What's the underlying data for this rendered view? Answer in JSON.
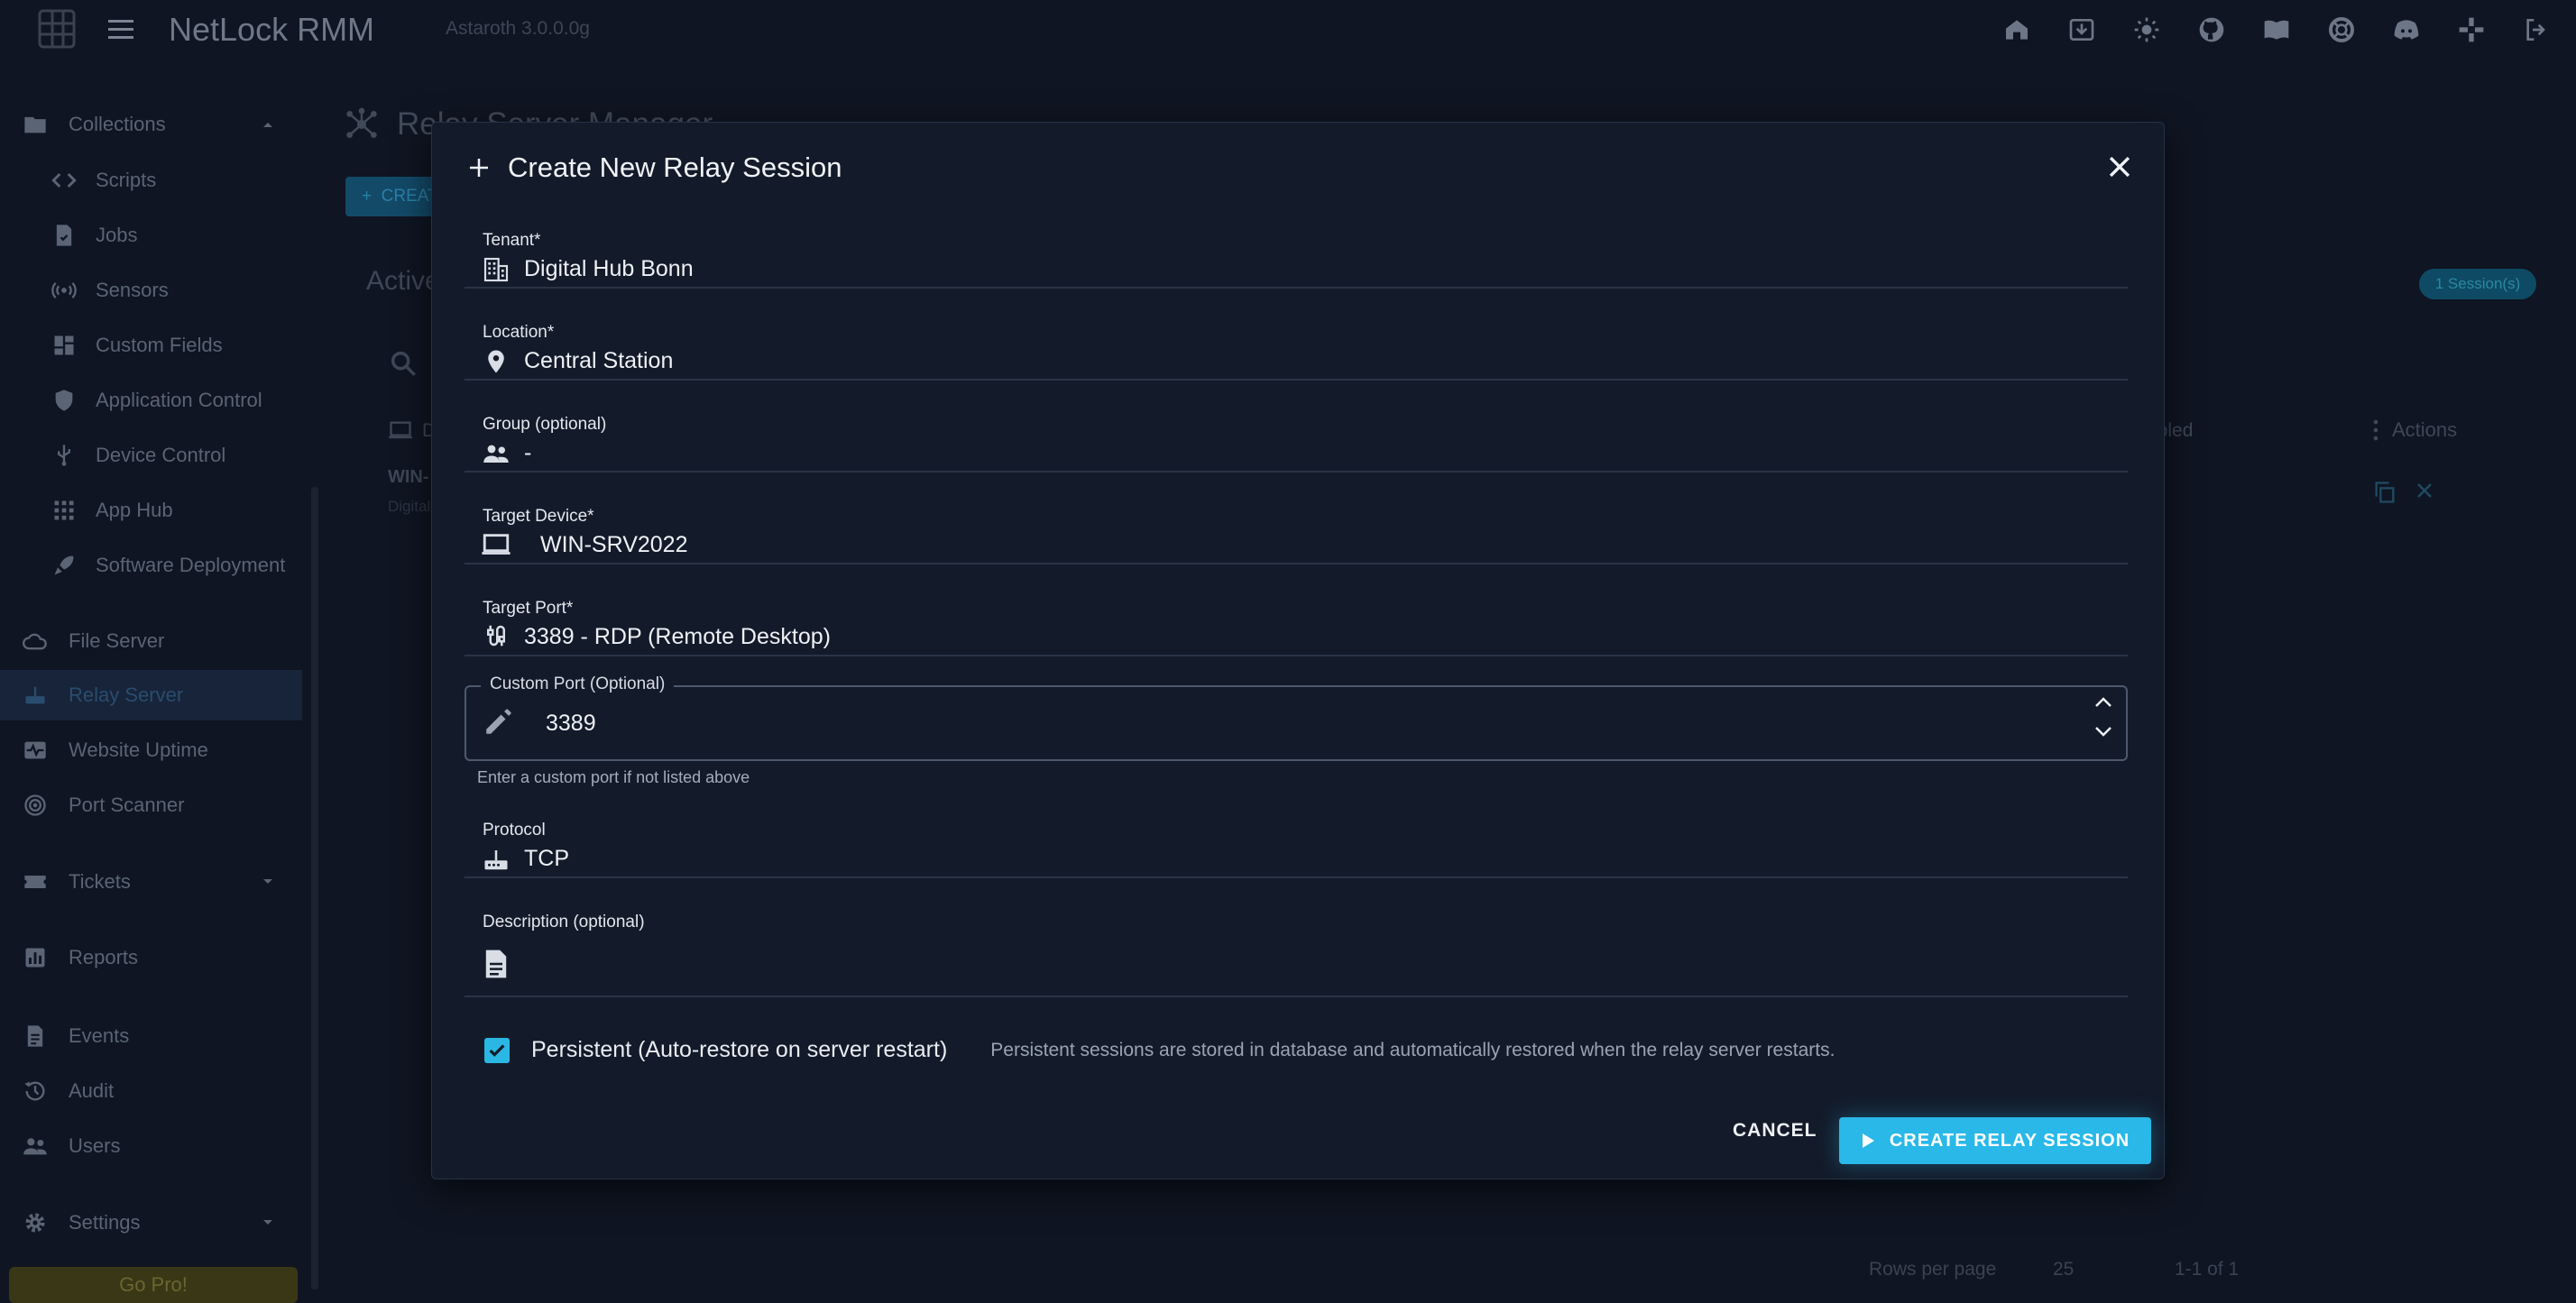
{
  "app": {
    "title": "NetLock RMM",
    "version": "Astaroth 3.0.0.0g"
  },
  "sidebar": {
    "items": [
      {
        "label": "Collections",
        "icon": "folder-icon"
      },
      {
        "label": "Scripts",
        "icon": "code-icon"
      },
      {
        "label": "Jobs",
        "icon": "job-icon"
      },
      {
        "label": "Sensors",
        "icon": "sensor-icon"
      },
      {
        "label": "Custom Fields",
        "icon": "dashboard-icon"
      },
      {
        "label": "Application Control",
        "icon": "shield-icon"
      },
      {
        "label": "Device Control",
        "icon": "usb-icon"
      },
      {
        "label": "App Hub",
        "icon": "apps-grid-icon"
      },
      {
        "label": "Software Deployment",
        "icon": "rocket-icon"
      },
      {
        "label": "File Server",
        "icon": "cloud-icon"
      },
      {
        "label": "Relay Server",
        "icon": "router-icon"
      },
      {
        "label": "Website Uptime",
        "icon": "monitor-heart-icon"
      },
      {
        "label": "Port Scanner",
        "icon": "radar-icon"
      },
      {
        "label": "Tickets",
        "icon": "ticket-icon"
      },
      {
        "label": "Reports",
        "icon": "bar-chart-icon"
      },
      {
        "label": "Events",
        "icon": "events-icon"
      },
      {
        "label": "Audit",
        "icon": "history-icon"
      },
      {
        "label": "Users",
        "icon": "people-icon"
      },
      {
        "label": "Settings",
        "icon": "gear-icon"
      }
    ],
    "go_pro": "Go Pro!"
  },
  "background": {
    "page_title": "Relay Server Manager",
    "create_label": "CREATE",
    "active_heading": "Active",
    "sessions_badge": "1 Session(s)",
    "col_device": "D",
    "row_device": "WIN-",
    "row_sub": "Digital",
    "col_enabled": "abled",
    "col_actions": "Actions",
    "rows_per_page_label": "Rows per page",
    "rows_per_page_value": "25",
    "page_range": "1-1 of 1"
  },
  "dialog": {
    "title": "Create New Relay Session",
    "fields": {
      "tenant": {
        "label": "Tenant*",
        "value": "Digital Hub Bonn",
        "icon": "building-icon"
      },
      "location": {
        "label": "Location*",
        "value": "Central Station",
        "icon": "location-pin-icon"
      },
      "group": {
        "label": "Group (optional)",
        "value": "-",
        "icon": "people-icon"
      },
      "target_device": {
        "label": "Target Device*",
        "value": "WIN-SRV2022",
        "icon": "laptop-icon"
      },
      "target_port": {
        "label": "Target Port*",
        "value": "3389 - RDP (Remote Desktop)",
        "icon": "cable-icon"
      },
      "custom_port": {
        "label": "Custom Port (Optional)",
        "value": "3389",
        "helper": "Enter a custom port if not listed above",
        "icon": "pencil-icon"
      },
      "protocol": {
        "label": "Protocol",
        "value": "TCP",
        "icon": "router-icon"
      },
      "description": {
        "label": "Description (optional)",
        "value": "",
        "icon": "document-icon"
      }
    },
    "persistent": {
      "checked": true,
      "label": "Persistent (Auto-restore on server restart)",
      "hint": "Persistent sessions are stored in database and automatically restored when the relay server restarts."
    },
    "cancel_label": "CANCEL",
    "submit_label": "CREATE RELAY SESSION"
  },
  "colors": {
    "accent": "#29b8e8",
    "background": "#0f1522",
    "dialog": "#131b2a"
  }
}
